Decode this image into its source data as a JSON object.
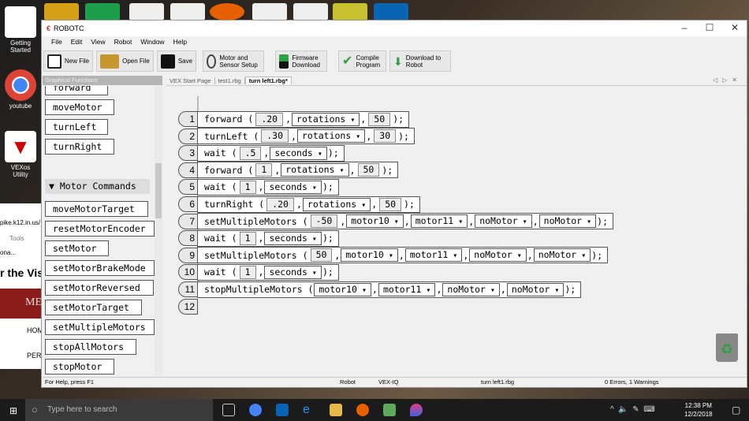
{
  "desktop": {
    "icons": [
      {
        "label": "Getting Started"
      },
      {
        "label": "youtube"
      },
      {
        "label": "VEXos Utility"
      }
    ],
    "browser": {
      "url": "pike.k12.in.us/",
      "menu": "Tools",
      "fav": "ona...",
      "heading": "r the Vis",
      "banner": "ME",
      "nav1": "HOM",
      "nav2": "PER"
    }
  },
  "window": {
    "title": "ROBOTC"
  },
  "menu": [
    "File",
    "Edit",
    "View",
    "Robot",
    "Window",
    "Help"
  ],
  "toolbar": [
    {
      "label": "New File"
    },
    {
      "label": "Open File"
    },
    {
      "label": "Save"
    },
    {
      "label": "Motor and Sensor Setup"
    },
    {
      "label": "Firmware Download"
    },
    {
      "label": "Compile Program"
    },
    {
      "label": "Download to Robot"
    }
  ],
  "sidebar": {
    "title": "Graphical Functions",
    "items": [
      "forward",
      "moveMotor",
      "turnLeft",
      "turnRight"
    ],
    "section": "▼ Motor Commands",
    "section_items": [
      "moveMotorTarget",
      "resetMotorEncoder",
      "setMotor",
      "setMotorBrakeMode",
      "setMotorReversed",
      "setMotorTarget",
      "setMultipleMotors",
      "stopAllMotors",
      "stopMotor",
      "stopMultipleMotors"
    ]
  },
  "tabs": [
    {
      "label": "VEX Start Page"
    },
    {
      "label": "test1.rbg"
    },
    {
      "label": "turn left1.rbg*",
      "active": true
    }
  ],
  "code": [
    {
      "n": "1",
      "fn": "forward",
      "args": [
        {
          "t": "f",
          "v": ".20"
        },
        {
          "t": "d",
          "v": "rotations"
        },
        {
          "t": "f",
          "v": "50"
        }
      ]
    },
    {
      "n": "2",
      "fn": "turnLeft",
      "args": [
        {
          "t": "f",
          "v": ".30"
        },
        {
          "t": "d",
          "v": "rotations"
        },
        {
          "t": "f",
          "v": "30"
        }
      ]
    },
    {
      "n": "3",
      "fn": "wait",
      "args": [
        {
          "t": "f",
          "v": ".5"
        },
        {
          "t": "d",
          "v": "seconds"
        }
      ]
    },
    {
      "n": "4",
      "fn": "forward",
      "args": [
        {
          "t": "f",
          "v": "1"
        },
        {
          "t": "d",
          "v": "rotations"
        },
        {
          "t": "f",
          "v": "50"
        }
      ]
    },
    {
      "n": "5",
      "fn": "wait",
      "args": [
        {
          "t": "f",
          "v": "1"
        },
        {
          "t": "d",
          "v": "seconds"
        }
      ]
    },
    {
      "n": "6",
      "fn": "turnRight",
      "args": [
        {
          "t": "f",
          "v": ".20"
        },
        {
          "t": "d",
          "v": "rotations"
        },
        {
          "t": "f",
          "v": "50"
        }
      ]
    },
    {
      "n": "7",
      "fn": "setMultipleMotors",
      "args": [
        {
          "t": "f",
          "v": "-50"
        },
        {
          "t": "d",
          "v": "motor10"
        },
        {
          "t": "d",
          "v": "motor11"
        },
        {
          "t": "d",
          "v": "noMotor"
        },
        {
          "t": "d",
          "v": "noMotor"
        }
      ]
    },
    {
      "n": "8",
      "fn": "wait",
      "args": [
        {
          "t": "f",
          "v": "1"
        },
        {
          "t": "d",
          "v": "seconds"
        }
      ]
    },
    {
      "n": "9",
      "fn": "setMultipleMotors",
      "args": [
        {
          "t": "f",
          "v": "50"
        },
        {
          "t": "d",
          "v": "motor10"
        },
        {
          "t": "d",
          "v": "motor11"
        },
        {
          "t": "d",
          "v": "noMotor"
        },
        {
          "t": "d",
          "v": "noMotor"
        }
      ]
    },
    {
      "n": "10",
      "fn": "wait",
      "args": [
        {
          "t": "f",
          "v": "1"
        },
        {
          "t": "d",
          "v": "seconds"
        }
      ]
    },
    {
      "n": "11",
      "fn": "stopMultipleMotors",
      "args": [
        {
          "t": "d",
          "v": "motor10"
        },
        {
          "t": "d",
          "v": "motor11"
        },
        {
          "t": "d",
          "v": "noMotor"
        },
        {
          "t": "d",
          "v": "noMotor"
        }
      ]
    },
    {
      "n": "12",
      "fn": "",
      "args": []
    }
  ],
  "status": {
    "help": "For Help, press F1",
    "robot": "Robot",
    "platform": "VEX-IQ",
    "file": "turn left1.rbg",
    "errors": "0 Errors, 1 Warnings"
  },
  "taskbar": {
    "search_placeholder": "Type here to search",
    "time": "12:38 PM",
    "date": "12/2/2018"
  }
}
